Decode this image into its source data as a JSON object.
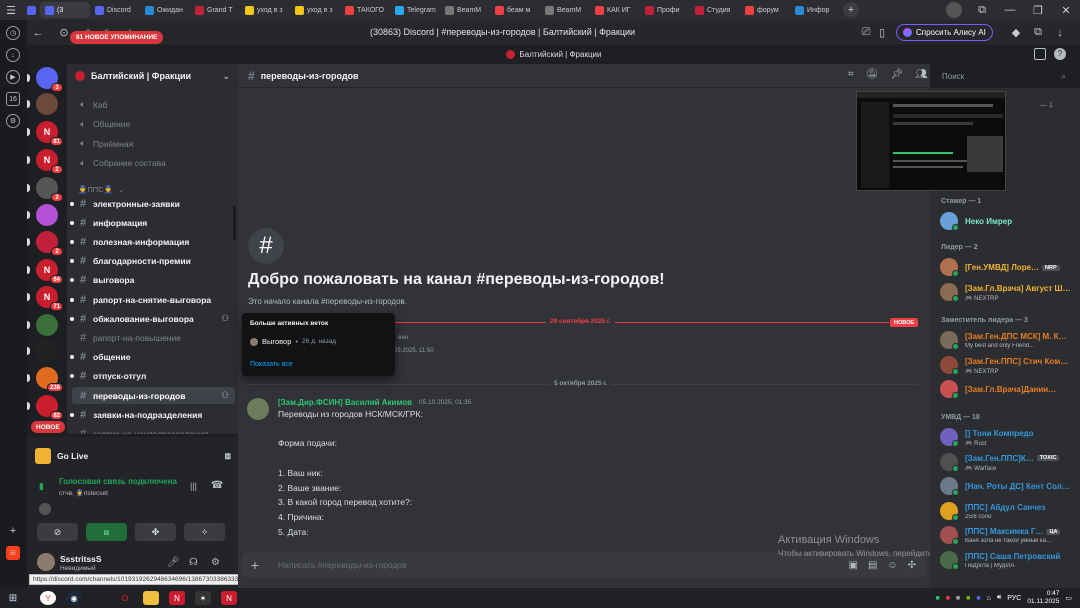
{
  "browser": {
    "tabs": [
      {
        "label": "",
        "color": "#5865f2",
        "active": false
      },
      {
        "label": "(3",
        "color": "#5865f2",
        "active": true
      },
      {
        "label": "Discord",
        "color": "#5865f2",
        "active": false
      },
      {
        "label": "Ожидан",
        "color": "#2b8ad6",
        "active": false
      },
      {
        "label": "Grand T",
        "color": "#c0203a",
        "active": false
      },
      {
        "label": "уход в з",
        "color": "#f5c518",
        "active": false
      },
      {
        "label": "уход в з",
        "color": "#f5c518",
        "active": false
      },
      {
        "label": "ТАКОГО",
        "color": "#f23f43",
        "active": false
      },
      {
        "label": "Telegram",
        "color": "#29a9eb",
        "active": false
      },
      {
        "label": "BeamM",
        "color": "#777777",
        "active": false
      },
      {
        "label": "беам м",
        "color": "#f23f43",
        "active": false
      },
      {
        "label": "BeamM",
        "color": "#777777",
        "active": false
      },
      {
        "label": "КАК ИГ",
        "color": "#f23f43",
        "active": false
      },
      {
        "label": "Профи",
        "color": "#c0203a",
        "active": false
      },
      {
        "label": "Студия",
        "color": "#c0203a",
        "active": false
      },
      {
        "label": "форум",
        "color": "#f23f43",
        "active": false
      },
      {
        "label": "Инфор",
        "color": "#2b8ad6",
        "active": false
      }
    ],
    "url": "discord.com",
    "page_title": "(30863) Discord | #переводы-из-городов | Балтийский | Фракции",
    "alice_label": "Спросить Алису AI",
    "status_url": "https://discord.com/channels/1019319262948634696/1386730338633388154"
  },
  "discord": {
    "top_label": "Балтийский | Фракции",
    "servers": [
      {
        "label": "",
        "color": "#5865f2",
        "badge": "3"
      },
      {
        "label": "",
        "color": "#6b4a3a",
        "badge": ""
      },
      {
        "label": "N",
        "color": "#c81e2e",
        "badge": "81"
      },
      {
        "label": "N",
        "color": "#c81e2e",
        "badge": "2"
      },
      {
        "label": "",
        "color": "#555555",
        "badge": "2"
      },
      {
        "label": "",
        "color": "#b54fd6",
        "badge": ""
      },
      {
        "label": "",
        "color": "#c0203a",
        "badge": "2"
      },
      {
        "label": "N",
        "color": "#c81e2e",
        "badge": "64"
      },
      {
        "label": "N",
        "color": "#c81e2e",
        "badge": "71"
      },
      {
        "label": "",
        "color": "#3a6f3a",
        "badge": ""
      },
      {
        "label": "",
        "color": "#222222",
        "badge": ""
      },
      {
        "label": "",
        "color": "#e06b20",
        "badge": "238"
      },
      {
        "label": "",
        "color": "#c81e2e",
        "badge": "82"
      }
    ],
    "server_name": "Балтийский | Фракции",
    "mention_pill": "81 НОВОЕ УПОМИНАНИЕ",
    "voice_channels": [
      "Каб",
      "Общение",
      "Приёмная",
      "Собрание состава"
    ],
    "category": "👮ППС👮",
    "channels": [
      {
        "name": "электронные-заявки",
        "state": "unread"
      },
      {
        "name": "информация",
        "state": "unread"
      },
      {
        "name": "полезная-информация",
        "state": "unread"
      },
      {
        "name": "благодарности-премии",
        "state": "unread"
      },
      {
        "name": "выговора",
        "state": "unread"
      },
      {
        "name": "рапорт-на-снятие-выговора",
        "state": "unread"
      },
      {
        "name": "обжалование-выговора",
        "state": "unread"
      },
      {
        "name": "рапорт-на-повышение",
        "state": "muted"
      },
      {
        "name": "общение",
        "state": "unread"
      },
      {
        "name": "отпуск-отгул",
        "state": "unread"
      },
      {
        "name": "переводы-из-городов",
        "state": "selected"
      },
      {
        "name": "заявки-на-подразделения",
        "state": "unread"
      },
      {
        "name": "заявки-на-начподразделения",
        "state": "muted"
      }
    ],
    "new_pill": "НОВОЕ",
    "voice": {
      "go_live": "Go Live",
      "status": "Голосовая связь подключена",
      "sub": "стчв, 👮ristecset"
    },
    "user": {
      "name": "SsstritssS",
      "status": "Невидимый"
    },
    "channel_header": "переводы-из-городов",
    "search_placeholder": "Поиск",
    "welcome_title": "Добро пожаловать на канал #переводы-из-городов!",
    "welcome_sub": "Это начало канала #переводы-из-городов.",
    "divider1": "29 сентября 2025 г.",
    "new_tag": "НОВОЕ",
    "divider2": "5 октября 2025 г.",
    "threads": {
      "title": "Больше активных веток",
      "item": "Выговор",
      "item_age": "26 д. назад",
      "link": "Показать все"
    },
    "peek_text1": "ено",
    "peek_text2": "09.2025, 11:50",
    "message": {
      "author": "[Зам.Дир.ФСИН] Василий Акимов",
      "time": "05.10.2025, 01:35",
      "lines": [
        "Переводы из городов НСК/МСК/ГРК:",
        "",
        "Форма подачи:",
        "",
        "1. Ваш ник:",
        "2. Ваше звание:",
        "3. В какой город перевод хотите?:",
        "4. Причина:",
        "5. Дата:"
      ]
    },
    "composer_placeholder": "Написать #переводы-из-городов",
    "windows_watermark": {
      "line1": "Активация Windows",
      "line2": "Чтобы активировать Windows, перейдите в раздел \"Параметры\"."
    },
    "members": {
      "groups": [
        {
          "title": "Стажер — 1",
          "members": [
            {
              "name": "Неко Имрер",
              "color": "#7ee8c8",
              "activity": "",
              "tag": ""
            }
          ]
        },
        {
          "title": "Лидер — 2",
          "members": [
            {
              "name": "[Ген.УМВД] Лоре…",
              "color": "#f0b232",
              "activity": "",
              "tag": "NRP"
            },
            {
              "name": "[Зам.Гл.Врача] Август Ш…",
              "color": "#f0b232",
              "activity": "🎮 NEXTRP",
              "tag": ""
            }
          ]
        },
        {
          "title": "Заместитель лидера — 3",
          "members": [
            {
              "name": "[Зам.Ген.ДПС МСК] М. К…",
              "color": "#e67e22",
              "activity": "My best and only Friend...",
              "tag": ""
            },
            {
              "name": "[Зам.Ген.ППС] Стич Ком…",
              "color": "#e67e22",
              "activity": "🎮 NEXTRP",
              "tag": ""
            },
            {
              "name": "[Зам.Гл.Врача]Дании…",
              "color": "#e67e22",
              "activity": "",
              "tag": ""
            }
          ]
        },
        {
          "title": "УМВД — 18",
          "members": [
            {
              "name": "[] Тони Компредо",
              "color": "#3498db",
              "activity": "🎮 Rust",
              "tag": ""
            },
            {
              "name": "[Зам.Ген.ППС]К…",
              "color": "#3498db",
              "activity": "🎮 Warface",
              "tag": "TOXIC"
            },
            {
              "name": "[Нач. Роты ДС] Кент Сол…",
              "color": "#3498db",
              "activity": "",
              "tag": ""
            },
            {
              "name": "[ППС] Абдул Санчез",
              "color": "#3498db",
              "activity": "25/8 соло",
              "tag": ""
            },
            {
              "name": "[ППС] Максимка Г…",
              "color": "#3498db",
              "activity": "Ваня зола не такой умный ка…",
              "tag": "ЦА"
            },
            {
              "name": "[ППС] Саша Петровский",
              "color": "#3498db",
              "activity": "ПеДрІЛа | МудІлА",
              "tag": ""
            }
          ]
        }
      ],
      "screenshare_count": "— 1"
    }
  },
  "taskbar": {
    "lang": "РУС",
    "time": "0:47",
    "date": "01.11.2025"
  }
}
